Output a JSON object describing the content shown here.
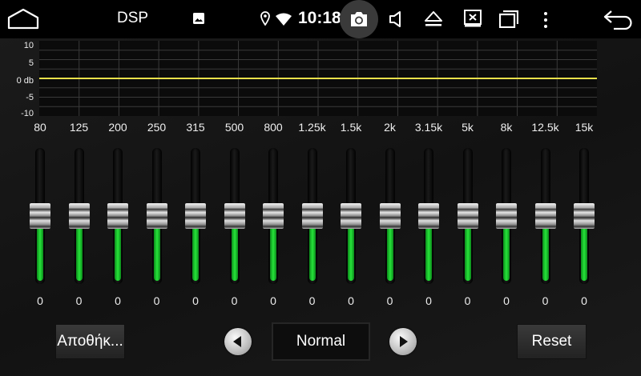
{
  "status_bar": {
    "title": "DSP",
    "time": "10:18",
    "icons": [
      "home-icon",
      "gallery-icon",
      "location-icon",
      "wifi-icon",
      "camera-icon",
      "volume-icon",
      "eject-icon",
      "close-box-icon",
      "window-icon",
      "more-icon",
      "back-icon"
    ]
  },
  "graph": {
    "ylabels": [
      "10",
      "5",
      "0 db",
      "-5",
      "-10"
    ],
    "ylim": [
      -10,
      10
    ],
    "curve_level_db": 0,
    "curve_color": "#e8e04a"
  },
  "eq": {
    "bands": [
      {
        "freq": "80",
        "value": "0"
      },
      {
        "freq": "125",
        "value": "0"
      },
      {
        "freq": "200",
        "value": "0"
      },
      {
        "freq": "250",
        "value": "0"
      },
      {
        "freq": "315",
        "value": "0"
      },
      {
        "freq": "500",
        "value": "0"
      },
      {
        "freq": "800",
        "value": "0"
      },
      {
        "freq": "1.25k",
        "value": "0"
      },
      {
        "freq": "1.5k",
        "value": "0"
      },
      {
        "freq": "2k",
        "value": "0"
      },
      {
        "freq": "3.15k",
        "value": "0"
      },
      {
        "freq": "5k",
        "value": "0"
      },
      {
        "freq": "8k",
        "value": "0"
      },
      {
        "freq": "12.5k",
        "value": "0"
      },
      {
        "freq": "15k",
        "value": "0"
      }
    ],
    "slider_fill_color": "#27e43a"
  },
  "controls": {
    "save_label": "Αποθήκ...",
    "preset_label": "Normal",
    "reset_label": "Reset"
  }
}
